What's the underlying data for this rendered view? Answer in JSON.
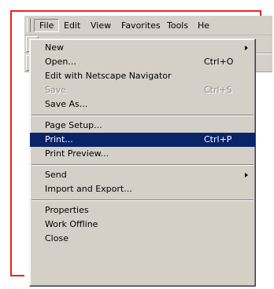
{
  "menubar": {
    "items": [
      {
        "label": "File",
        "active": true
      },
      {
        "label": "Edit"
      },
      {
        "label": "View"
      },
      {
        "label": "Favorites"
      },
      {
        "label": "Tools"
      },
      {
        "label": "He"
      }
    ]
  },
  "file_menu": {
    "new": {
      "label": "New",
      "submenu": true
    },
    "open": {
      "label": "Open...",
      "shortcut": "Ctrl+O"
    },
    "edit_with": {
      "label": "Edit with Netscape Navigator"
    },
    "save": {
      "label": "Save",
      "shortcut": "Ctrl+S",
      "disabled": true
    },
    "save_as": {
      "label": "Save As..."
    },
    "page_setup": {
      "label": "Page Setup..."
    },
    "print": {
      "label": "Print...",
      "shortcut": "Ctrl+P",
      "selected": true
    },
    "print_preview": {
      "label": "Print Preview..."
    },
    "send": {
      "label": "Send",
      "submenu": true
    },
    "import_export": {
      "label": "Import and Export..."
    },
    "properties": {
      "label": "Properties"
    },
    "work_offline": {
      "label": "Work Offline"
    },
    "close": {
      "label": "Close"
    }
  },
  "colors": {
    "highlight": "#0a246a",
    "menu_bg": "#d4d0c8",
    "frame_border": "#e8231f"
  }
}
